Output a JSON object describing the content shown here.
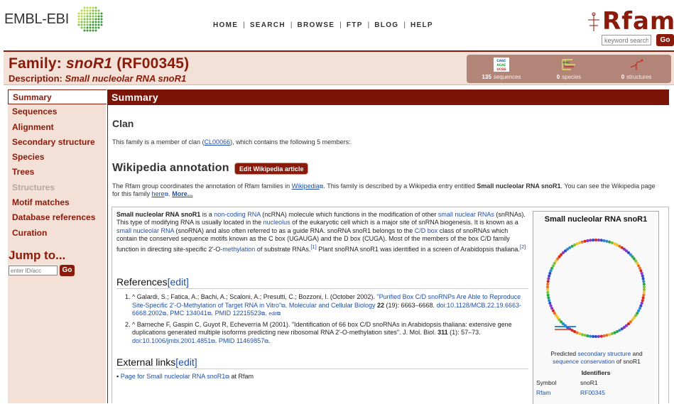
{
  "header": {
    "ebi_logo": "EMBL-EBI",
    "nav": [
      "HOME",
      "SEARCH",
      "BROWSE",
      "FTP",
      "BLOG",
      "HELP"
    ],
    "rfam_logo": "Rfam",
    "search_placeholder": "keyword search",
    "search_go": "Go"
  },
  "family": {
    "label": "Family:",
    "name": "snoR1",
    "accession": "(RF00345)",
    "desc_label": "Description:",
    "description": "Small nucleolar RNA snoR1"
  },
  "stats": {
    "sequences_count": "135",
    "sequences_label": "sequences",
    "species_count": "0",
    "species_label": "species",
    "structures_count": "0",
    "structures_label": "structures"
  },
  "sidebar": {
    "items": [
      {
        "label": "Summary",
        "state": "active"
      },
      {
        "label": "Sequences",
        "state": "normal"
      },
      {
        "label": "Alignment",
        "state": "normal"
      },
      {
        "label": "Secondary structure",
        "state": "normal"
      },
      {
        "label": "Species",
        "state": "normal"
      },
      {
        "label": "Trees",
        "state": "normal"
      },
      {
        "label": "Structures",
        "state": "disabled"
      },
      {
        "label": "Motif matches",
        "state": "normal"
      },
      {
        "label": "Database references",
        "state": "normal"
      },
      {
        "label": "Curation",
        "state": "normal"
      }
    ],
    "jump_title": "Jump to...",
    "jump_placeholder": "enter ID/acc",
    "jump_go": "Go"
  },
  "main": {
    "summary_title": "Summary",
    "clan_heading": "Clan",
    "clan_text_pre": "This family is a member of clan (",
    "clan_link": "CL00066",
    "clan_text_post": "), which contains the following 5 members:",
    "wiki_heading": "Wikipedia annotation",
    "wiki_edit_button": "Edit Wikipedia article",
    "wiki_intro_1": "The Rfam group coordinates the annotation of Rfam families in ",
    "wiki_intro_link": "Wikipedia",
    "wiki_intro_2": ". This family is described by a Wikipedia entry entitled ",
    "wiki_intro_entry": "Small nucleolar RNA snoR1",
    "wiki_intro_3": ". You can see the Wikipedia page for this family ",
    "wiki_intro_here": "here",
    "wiki_intro_more": "More...",
    "references_heading": "References",
    "external_heading": "External links",
    "edit_label": "[edit]",
    "external_link": "Page for Small nucleolar RNA snoR1",
    "external_link_suffix": " at Rfam"
  },
  "infobox": {
    "title": "Small nucleolar RNA snoR1",
    "caption_pre": "Predicted ",
    "caption_link1": "secondary structure",
    "caption_mid": " and ",
    "caption_link2": "sequence conservation",
    "caption_post": " of snoR1",
    "identifiers_heading": "Identifiers",
    "rows": [
      {
        "key": "Symbol",
        "value": "snoR1"
      },
      {
        "key": "Rfam",
        "value": "RF00345"
      }
    ]
  },
  "colors": {
    "brand": "#8a1a0a",
    "panel": "#f3e0d6",
    "link": "#1f4fa8"
  }
}
